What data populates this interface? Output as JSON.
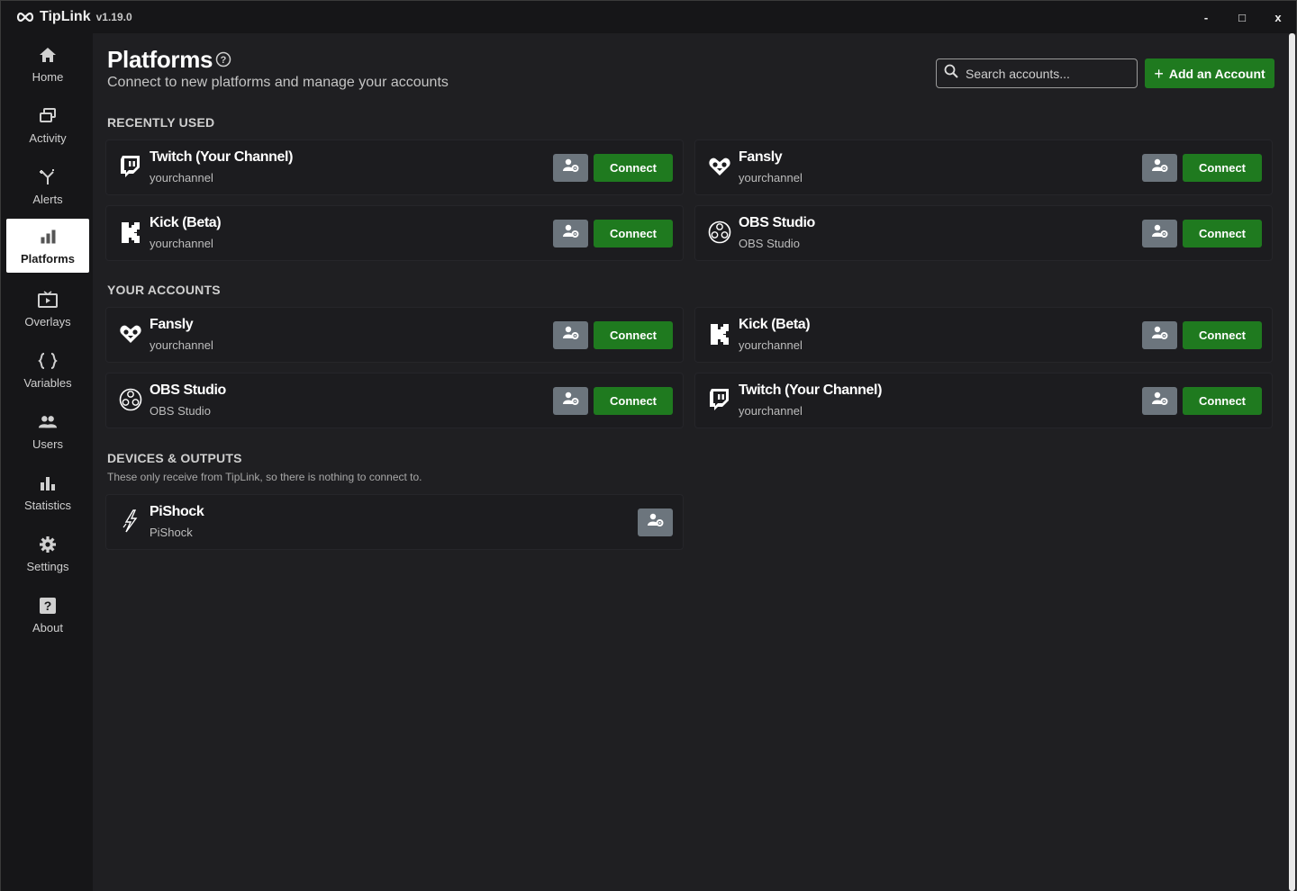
{
  "app": {
    "name": "TipLink",
    "version": "v1.19.0"
  },
  "window_controls": {
    "minimize": "-",
    "maximize": "□",
    "close": "x"
  },
  "sidebar": {
    "items": [
      {
        "label": "Home",
        "icon": "home-icon"
      },
      {
        "label": "Activity",
        "icon": "activity-icon"
      },
      {
        "label": "Alerts",
        "icon": "alerts-icon"
      },
      {
        "label": "Platforms",
        "icon": "platforms-icon",
        "active": true
      },
      {
        "label": "Overlays",
        "icon": "overlays-icon"
      },
      {
        "label": "Variables",
        "icon": "variables-icon"
      },
      {
        "label": "Users",
        "icon": "users-icon"
      },
      {
        "label": "Statistics",
        "icon": "statistics-icon"
      },
      {
        "label": "Settings",
        "icon": "settings-icon"
      },
      {
        "label": "About",
        "icon": "about-icon"
      }
    ]
  },
  "header": {
    "title": "Platforms",
    "subtitle": "Connect to new platforms and manage your accounts",
    "search_placeholder": "Search accounts...",
    "add_button": "Add an Account",
    "add_plus": "+"
  },
  "sections": {
    "recent": {
      "title": "RECENTLY USED",
      "cards": [
        {
          "name": "Twitch (Your Channel)",
          "sub": "yourchannel",
          "icon": "twitch-icon",
          "connect": "Connect"
        },
        {
          "name": "Fansly",
          "sub": "yourchannel",
          "icon": "fansly-icon",
          "connect": "Connect"
        },
        {
          "name": "Kick (Beta)",
          "sub": "yourchannel",
          "icon": "kick-icon",
          "connect": "Connect"
        },
        {
          "name": "OBS Studio",
          "sub": "OBS Studio",
          "icon": "obs-icon",
          "connect": "Connect"
        }
      ]
    },
    "accounts": {
      "title": "YOUR ACCOUNTS",
      "cards": [
        {
          "name": "Fansly",
          "sub": "yourchannel",
          "icon": "fansly-icon",
          "connect": "Connect"
        },
        {
          "name": "Kick (Beta)",
          "sub": "yourchannel",
          "icon": "kick-icon",
          "connect": "Connect"
        },
        {
          "name": "OBS Studio",
          "sub": "OBS Studio",
          "icon": "obs-icon",
          "connect": "Connect"
        },
        {
          "name": "Twitch (Your Channel)",
          "sub": "yourchannel",
          "icon": "twitch-icon",
          "connect": "Connect"
        }
      ]
    },
    "devices": {
      "title": "DEVICES & OUTPUTS",
      "note": "These only receive from TipLink, so there is nothing to connect to.",
      "cards": [
        {
          "name": "PiShock",
          "sub": "PiShock",
          "icon": "pishock-icon"
        }
      ]
    }
  },
  "colors": {
    "accent_green": "#1f7a1f",
    "settings_gray": "#6c757d",
    "background": "#1f1f22",
    "sidebar": "#161618"
  }
}
